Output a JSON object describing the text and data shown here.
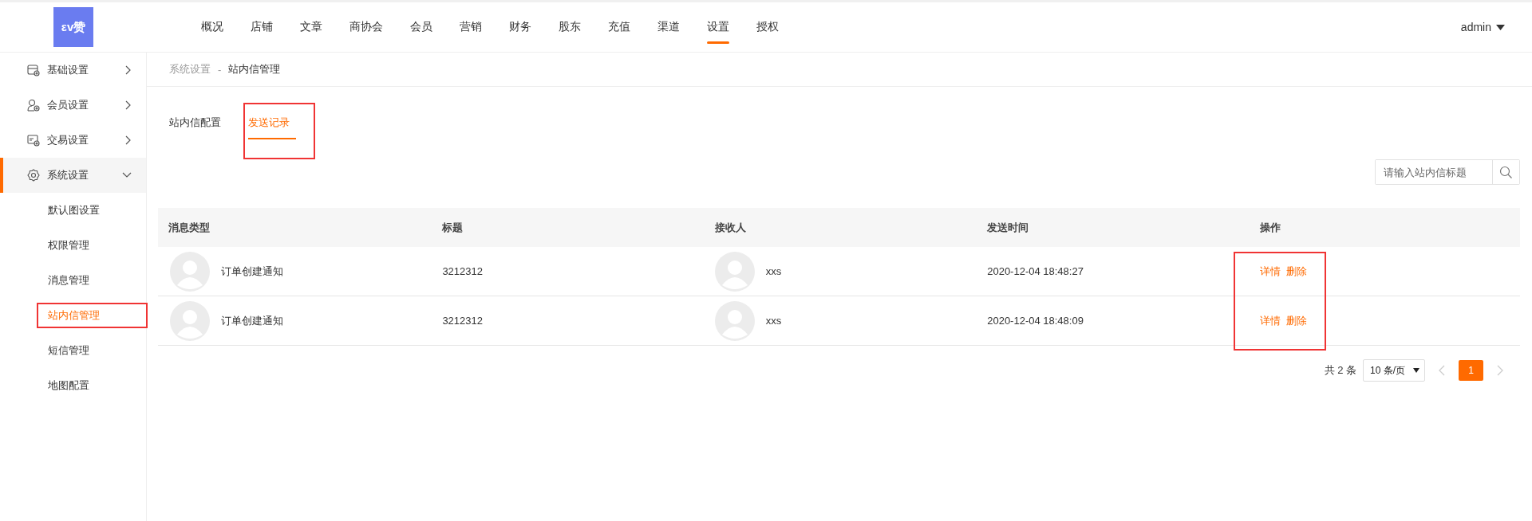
{
  "logo": {
    "text": "εv赞"
  },
  "nav": [
    {
      "label": "概况",
      "selected": false
    },
    {
      "label": "店铺",
      "selected": false
    },
    {
      "label": "文章",
      "selected": false
    },
    {
      "label": "商协会",
      "selected": false
    },
    {
      "label": "会员",
      "selected": false
    },
    {
      "label": "营销",
      "selected": false
    },
    {
      "label": "财务",
      "selected": false
    },
    {
      "label": "股东",
      "selected": false
    },
    {
      "label": "充值",
      "selected": false
    },
    {
      "label": "渠道",
      "selected": false
    },
    {
      "label": "设置",
      "selected": true
    },
    {
      "label": "授权",
      "selected": false
    }
  ],
  "user": {
    "name": "admin"
  },
  "sidebar": {
    "items": [
      {
        "label": "基础设置",
        "expanded": false,
        "selected": false
      },
      {
        "label": "会员设置",
        "expanded": false,
        "selected": false
      },
      {
        "label": "交易设置",
        "expanded": false,
        "selected": false
      },
      {
        "label": "系统设置",
        "expanded": true,
        "selected": true,
        "children": [
          {
            "label": "默认图设置",
            "selected": false,
            "highlighted": false
          },
          {
            "label": "权限管理",
            "selected": false,
            "highlighted": false
          },
          {
            "label": "消息管理",
            "selected": false,
            "highlighted": false
          },
          {
            "label": "站内信管理",
            "selected": true,
            "highlighted": true
          },
          {
            "label": "短信管理",
            "selected": false,
            "highlighted": false
          },
          {
            "label": "地图配置",
            "selected": false,
            "highlighted": false
          }
        ]
      }
    ]
  },
  "breadcrumb": {
    "items": [
      "系统设置",
      "站内信管理"
    ],
    "separator": "-"
  },
  "tabs": [
    {
      "label": "站内信配置",
      "selected": false,
      "highlighted": false
    },
    {
      "label": "发送记录",
      "selected": true,
      "highlighted": true
    }
  ],
  "search": {
    "placeholder": "请输入站内信标题"
  },
  "table": {
    "columns": [
      "消息类型",
      "标题",
      "接收人",
      "发送时间",
      "操作"
    ],
    "actions_highlighted": true,
    "rows": [
      {
        "type": "订单创建通知",
        "title": "3212312",
        "recipient": "xxs",
        "sent_at": "2020-12-04 18:48:27",
        "actions": [
          "详情",
          "删除"
        ]
      },
      {
        "type": "订单创建通知",
        "title": "3212312",
        "recipient": "xxs",
        "sent_at": "2020-12-04 18:48:09",
        "actions": [
          "详情",
          "删除"
        ]
      }
    ]
  },
  "pagination": {
    "total": "共 2 条",
    "page_size": "10 条/页",
    "pages": [
      {
        "label": "1",
        "selected": true
      }
    ]
  }
}
